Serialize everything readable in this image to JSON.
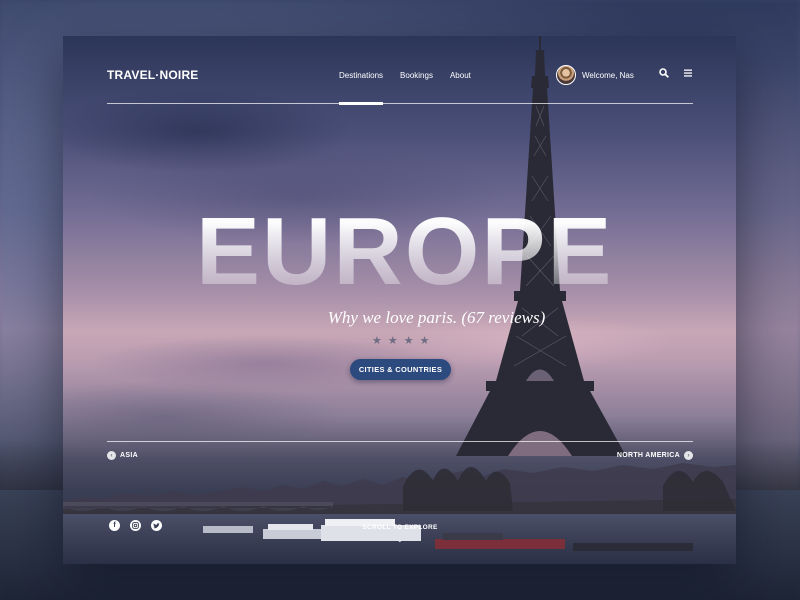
{
  "brand": {
    "logo": "TRAVEL·NOIRE"
  },
  "nav": {
    "links": [
      {
        "label": "Destinations",
        "active": true
      },
      {
        "label": "Bookings",
        "active": false
      },
      {
        "label": "About",
        "active": false
      }
    ],
    "user_greeting": "Welcome, Nas",
    "icons": [
      "search-icon",
      "menu-icon"
    ]
  },
  "hero": {
    "title": "EUROPE",
    "tagline": "Why we love paris. (67 reviews)",
    "rating": 4,
    "cta_label": "CITIES & COUNTRIES"
  },
  "regions": {
    "prev_label": "ASIA",
    "next_label": "NORTH AMERICA"
  },
  "footer": {
    "social_icons": [
      "facebook-icon",
      "instagram-icon",
      "twitter-icon"
    ],
    "scroll_label": "SCROLL TO EXPLORE"
  },
  "colors": {
    "cta": "#2c4a7e",
    "text": "#ffffff"
  }
}
